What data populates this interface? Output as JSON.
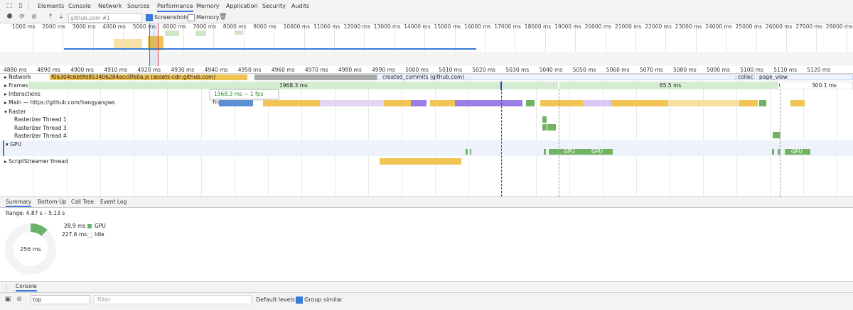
{
  "devtools_tabs": [
    "Elements",
    "Console",
    "Network",
    "Sources",
    "Performance",
    "Memory",
    "Application",
    "Security",
    "Audits"
  ],
  "toolbar": {
    "target": "github.com #1",
    "screenshots_label": "Screenshots",
    "memory_label": "Memory"
  },
  "overview_ticks": [
    "1000 ms",
    "2000 ms",
    "3000 ms",
    "4000 ms",
    "5000 ms",
    "6000 ms",
    "7000 ms",
    "8000 ms",
    "9000 ms",
    "10000 ms",
    "11000 ms",
    "12000 ms",
    "13000 ms",
    "14000 ms",
    "15000 ms",
    "16000 ms",
    "17000 ms",
    "18000 ms",
    "19000 ms",
    "20000 ms",
    "21000 ms",
    "22000 ms",
    "23000 ms",
    "24000 ms",
    "25000 ms",
    "26000 ms",
    "27000 ms",
    "28000 ms"
  ],
  "ruler_ticks": [
    "4880 ms",
    "4890 ms",
    "4900 ms",
    "4910 ms",
    "4920 ms",
    "4930 ms",
    "4940 ms",
    "4950 ms",
    "4960 ms",
    "4970 ms",
    "4980 ms",
    "4990 ms",
    "5000 ms",
    "5010 ms",
    "5020 ms",
    "5030 ms",
    "5040 ms",
    "5050 ms",
    "5060 ms",
    "5070 ms",
    "5080 ms",
    "5090 ms",
    "5100 ms",
    "5110 ms",
    "5120 ms"
  ],
  "network": {
    "label": "Network",
    "req1": "f06304c6b9fd853406284acc0fe0a.js (assets-cdn.github.com)",
    "req2": "created_commits (github.com)",
    "req3": "collec",
    "req4": "page_view (collector.githubapp.com)"
  },
  "frames": {
    "label": "Frames",
    "f1": "1968.3 ms",
    "f2": "65.5 ms",
    "f3": "300.1 ms"
  },
  "tooltip": {
    "value": "1968.3 ms ~ 1 fps",
    "label": "Frame"
  },
  "tracks": {
    "interactions": "Interactions",
    "main": "Main — https://github.com/hangyangws",
    "raster": "Raster",
    "r1": "Rasterizer Thread 1",
    "r3": "Rasterizer Thread 3",
    "r4": "Rasterizer Thread 4",
    "gpu": "GPU",
    "script": "ScriptStreamer thread",
    "gpu_block": "GPU"
  },
  "summary_tabs": [
    "Summary",
    "Bottom-Up",
    "Call Tree",
    "Event Log"
  ],
  "summary": {
    "range": "Range: 4.87 s – 5.13 s",
    "total": "256 ms",
    "gpu_ms": "28.9 ms",
    "gpu_label": "GPU",
    "idle_ms": "227.6 ms",
    "idle_label": "Idle",
    "gpu_fraction": 0.113,
    "gpu_color": "#6cb26c"
  },
  "console": {
    "tab": "Console",
    "context": "top",
    "filter_placeholder": "Filter",
    "levels": "Default levels ▾",
    "group_similar": "Group similar"
  },
  "colors": {
    "script": "#f1c453",
    "rendering": "#9a7ee6",
    "painting": "#71b363",
    "network_gray": "#a8a8a8",
    "frames": "#d6ecd2",
    "selection": "#3879d9"
  }
}
